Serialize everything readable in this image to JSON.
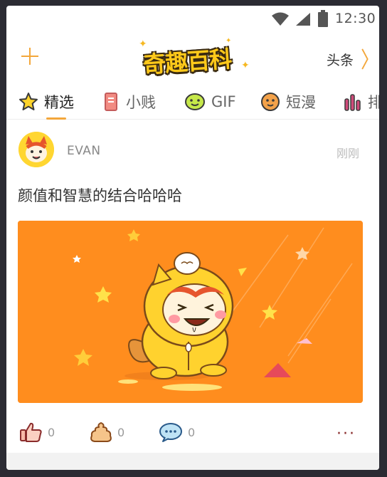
{
  "status_bar": {
    "time": "12:30"
  },
  "header": {
    "logo_text": "奇趣百科",
    "right_link": "头条",
    "right_chevron": "〉"
  },
  "tabs": [
    {
      "label": "精选",
      "icon": "star-icon",
      "active": true
    },
    {
      "label": "小贱",
      "icon": "bookmark-icon",
      "active": false
    },
    {
      "label": "GIF",
      "icon": "gif-face-icon",
      "active": false
    },
    {
      "label": "短漫",
      "icon": "face-icon",
      "active": false
    },
    {
      "label": "排",
      "icon": "bars-icon",
      "active": false
    }
  ],
  "post": {
    "username": "EVAN",
    "timestamp": "刚刚",
    "text": "颜值和智慧的结合哈哈哈",
    "actions": {
      "like_count": "0",
      "poop_count": "0",
      "comment_count": "0"
    },
    "more": "···"
  },
  "colors": {
    "accent": "#f3a73b",
    "image_bg": "#ff8d1e",
    "logo_yellow": "#ffc91a"
  }
}
